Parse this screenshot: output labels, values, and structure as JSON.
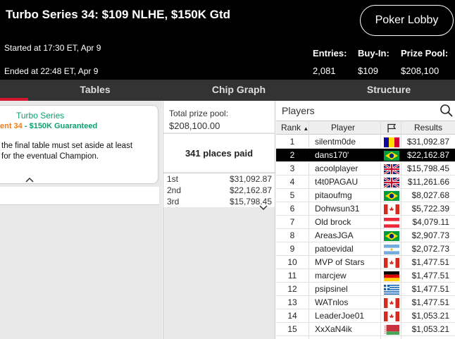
{
  "header": {
    "title": "Turbo Series 34: $109 NLHE, $150K Gtd",
    "lobby_button": "Poker Lobby",
    "started": "Started at 17:30 ET, Apr 9",
    "ended": "Ended at 22:48 ET, Apr 9",
    "stats": [
      {
        "label": "Entries:",
        "value": "2,081"
      },
      {
        "label": "Buy-In:",
        "value": "$109"
      },
      {
        "label": "Prize Pool:",
        "value": "$208,100"
      }
    ]
  },
  "tabs": [
    {
      "label": "Tables"
    },
    {
      "label": "Chip Graph"
    },
    {
      "label": "Structure"
    }
  ],
  "info_card": {
    "series": "Turbo Series",
    "event": "ent 34",
    "separator": " - ",
    "guarantee": "$150K Guaranteed",
    "desc_line1": "the final table must set aside at least",
    "desc_line2": "for the eventual Champion."
  },
  "prize": {
    "pool_label": "Total prize pool:",
    "pool_value": "$208,100.00",
    "places_paid": "341 places paid",
    "places": [
      {
        "place": "1st",
        "amount": "$31,092.87"
      },
      {
        "place": "2nd",
        "amount": "$22,162.87"
      },
      {
        "place": "3rd",
        "amount": "$15,798.45"
      }
    ]
  },
  "players": {
    "title": "Players",
    "headers": {
      "rank": "Rank",
      "player": "Player",
      "results": "Results"
    },
    "sort_indicator": "▲",
    "rows": [
      {
        "rank": "1",
        "name": "silentm0de",
        "flag": "andorra",
        "result": "$31,092.87"
      },
      {
        "rank": "2",
        "name": "dans170'",
        "flag": "brazil",
        "result": "$22,162.87"
      },
      {
        "rank": "3",
        "name": "acoolplayer",
        "flag": "uk",
        "result": "$15,798.45"
      },
      {
        "rank": "4",
        "name": "t4t0PAGAU",
        "flag": "uk",
        "result": "$11,261.66"
      },
      {
        "rank": "5",
        "name": "pitaoufmg",
        "flag": "brazil",
        "result": "$8,027.68"
      },
      {
        "rank": "6",
        "name": "Dohwsun31",
        "flag": "canada",
        "result": "$5,722.39"
      },
      {
        "rank": "7",
        "name": "Old brock",
        "flag": "austria",
        "result": "$4,079.11"
      },
      {
        "rank": "8",
        "name": "AreasJGA",
        "flag": "brazil",
        "result": "$2,907.73"
      },
      {
        "rank": "9",
        "name": "patoevidal",
        "flag": "argentina",
        "result": "$2,072.73"
      },
      {
        "rank": "10",
        "name": "MVP of Stars",
        "flag": "canada",
        "result": "$1,477.51"
      },
      {
        "rank": "11",
        "name": "marcjew",
        "flag": "germany",
        "result": "$1,477.51"
      },
      {
        "rank": "12",
        "name": "psipsinel",
        "flag": "greece",
        "result": "$1,477.51"
      },
      {
        "rank": "13",
        "name": "WATnlos",
        "flag": "canada",
        "result": "$1,477.51"
      },
      {
        "rank": "14",
        "name": "LeaderJoe01",
        "flag": "canada",
        "result": "$1,053.21"
      },
      {
        "rank": "15",
        "name": "XxXaN4ik",
        "flag": "belarus",
        "result": "$1,053.21"
      }
    ],
    "selected_rank": "2"
  },
  "colors": {
    "accent_red": "#d3152e",
    "series_green": "#0e9f6e",
    "event_orange": "#f07a14"
  },
  "icons": [
    "search-icon",
    "flag-icon",
    "chevron-up-icon",
    "chevron-down-icon"
  ]
}
